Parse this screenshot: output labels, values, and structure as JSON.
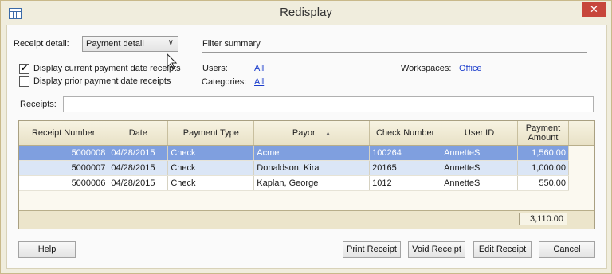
{
  "window": {
    "title": "Redisplay",
    "close_glyph": "✕"
  },
  "filters": {
    "receipt_detail_label": "Receipt detail:",
    "receipt_detail_value": "Payment detail",
    "filter_summary_label": "Filter summary",
    "display_current_label": "Display current payment date receipts",
    "display_current_checked": true,
    "display_prior_label": "Display prior payment date receipts",
    "display_prior_checked": false,
    "users_label": "Users:",
    "users_value": "All",
    "categories_label": "Categories:",
    "categories_value": "All",
    "workspaces_label": "Workspaces:",
    "workspaces_value": "Office",
    "receipts_label": "Receipts:",
    "receipts_value": ""
  },
  "grid": {
    "columns": [
      "Receipt Number",
      "Date",
      "Payment Type",
      "Payor",
      "Check Number",
      "User ID",
      "Payment Amount"
    ],
    "rows": [
      {
        "receipt_number": "5000008",
        "date": "04/28/2015",
        "payment_type": "Check",
        "payor": "Acme",
        "check_number": "100264",
        "user_id": "AnnetteS",
        "amount": "1,560.00"
      },
      {
        "receipt_number": "5000007",
        "date": "04/28/2015",
        "payment_type": "Check",
        "payor": "Donaldson, Kira",
        "check_number": "20165",
        "user_id": "AnnetteS",
        "amount": "1,000.00"
      },
      {
        "receipt_number": "5000006",
        "date": "04/28/2015",
        "payment_type": "Check",
        "payor": "Kaplan, George",
        "check_number": "1012",
        "user_id": "AnnetteS",
        "amount": "550.00"
      }
    ],
    "total": "3,110.00"
  },
  "buttons": {
    "help": "Help",
    "print_receipt": "Print Receipt",
    "void_receipt": "Void Receipt",
    "edit_receipt": "Edit Receipt",
    "cancel": "Cancel"
  },
  "colors": {
    "selected_row": "#7f9fdf",
    "alt_row": "#dbe6f6",
    "close_button": "#c7463c",
    "link": "#1a3ccc"
  }
}
